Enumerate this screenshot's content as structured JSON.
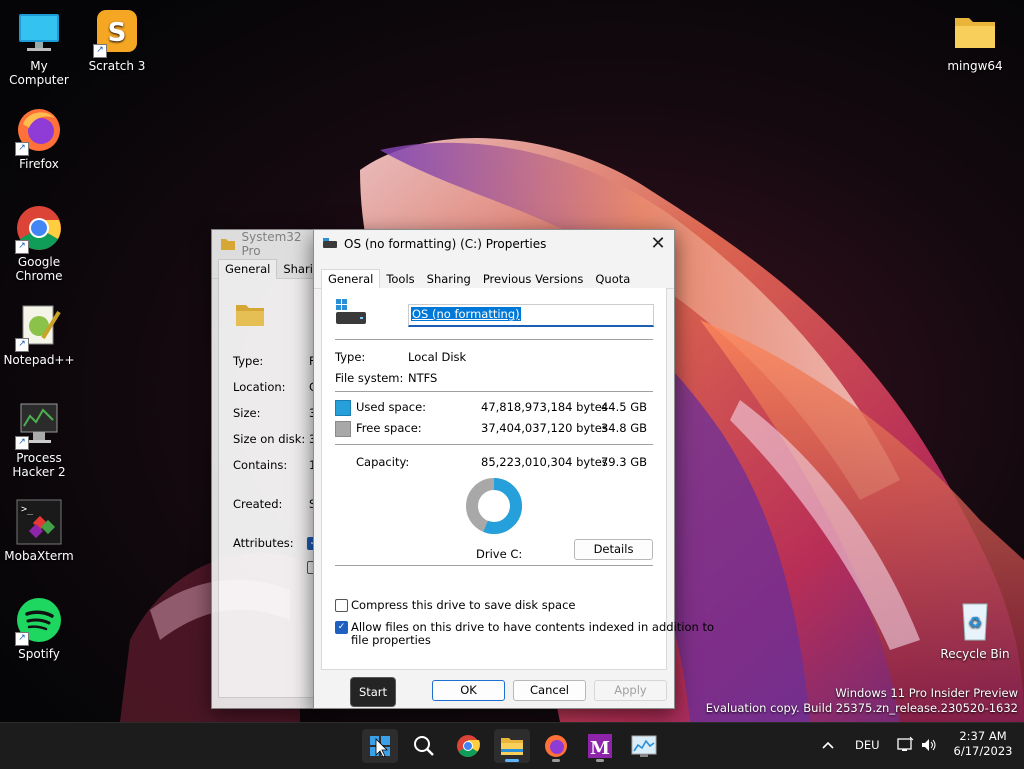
{
  "desktop": {
    "icons": [
      {
        "label": "My Computer",
        "icon": "monitor-icon"
      },
      {
        "label": "Scratch 3",
        "icon": "scratch-icon"
      },
      {
        "label": "Firefox",
        "icon": "firefox-icon"
      },
      {
        "label": "Google Chrome",
        "icon": "chrome-icon"
      },
      {
        "label": "Notepad++",
        "icon": "notepadpp-icon"
      },
      {
        "label": "Process Hacker 2",
        "icon": "process-hacker-icon"
      },
      {
        "label": "MobaXterm",
        "icon": "mobaxterm-icon"
      },
      {
        "label": "Spotify",
        "icon": "spotify-icon"
      },
      {
        "label": "mingw64",
        "icon": "folder-icon"
      },
      {
        "label": "Recycle Bin",
        "icon": "recycle-bin-icon"
      }
    ],
    "watermark": {
      "line1": "Windows 11 Pro Insider Preview",
      "line2": "Evaluation copy. Build 25375.zn_release.230520-1632"
    }
  },
  "bg_window": {
    "title": "System32 Pro",
    "tabs": [
      "General",
      "Sharing"
    ],
    "labels": [
      "Type:",
      "Location:",
      "Size:",
      "Size on disk:",
      "Contains:",
      "Created:",
      "Attributes:"
    ],
    "value_fragments": [
      "F",
      "C",
      "3",
      "3",
      "1",
      "S"
    ]
  },
  "dialog": {
    "title": "OS (no formatting) (C:) Properties",
    "tabs": [
      "General",
      "Tools",
      "Sharing",
      "Previous Versions",
      "Quota"
    ],
    "drive_name": "OS (no formatting)",
    "type_label": "Type:",
    "type_value": "Local Disk",
    "fs_label": "File system:",
    "fs_value": "NTFS",
    "used_label": "Used space:",
    "used_bytes": "47,818,973,184 bytes",
    "used_gb": "44.5 GB",
    "free_label": "Free space:",
    "free_bytes": "37,404,037,120 bytes",
    "free_gb": "34.8 GB",
    "capacity_label": "Capacity:",
    "capacity_bytes": "85,223,010,304 bytes",
    "capacity_gb": "79.3 GB",
    "used_fraction": 0.561,
    "drive_caption": "Drive C:",
    "details_button": "Details",
    "compress_label": "Compress this drive to save disk space",
    "compress_checked": false,
    "index_label": "Allow files on this drive to have contents indexed in addition to",
    "index_label2": "file properties",
    "index_checked": true,
    "ok": "OK",
    "cancel": "Cancel",
    "apply": "Apply",
    "colors": {
      "used": "#26a0da",
      "free": "#a8a8a8"
    }
  },
  "tooltip": "Start",
  "taskbar": {
    "apps": [
      "start-icon",
      "search-icon",
      "chrome-icon",
      "file-explorer-icon",
      "firefox-icon",
      "mobaxterm-icon",
      "resource-monitor-icon"
    ],
    "language": "DEU",
    "time": "2:37 AM",
    "date": "6/17/2023"
  }
}
